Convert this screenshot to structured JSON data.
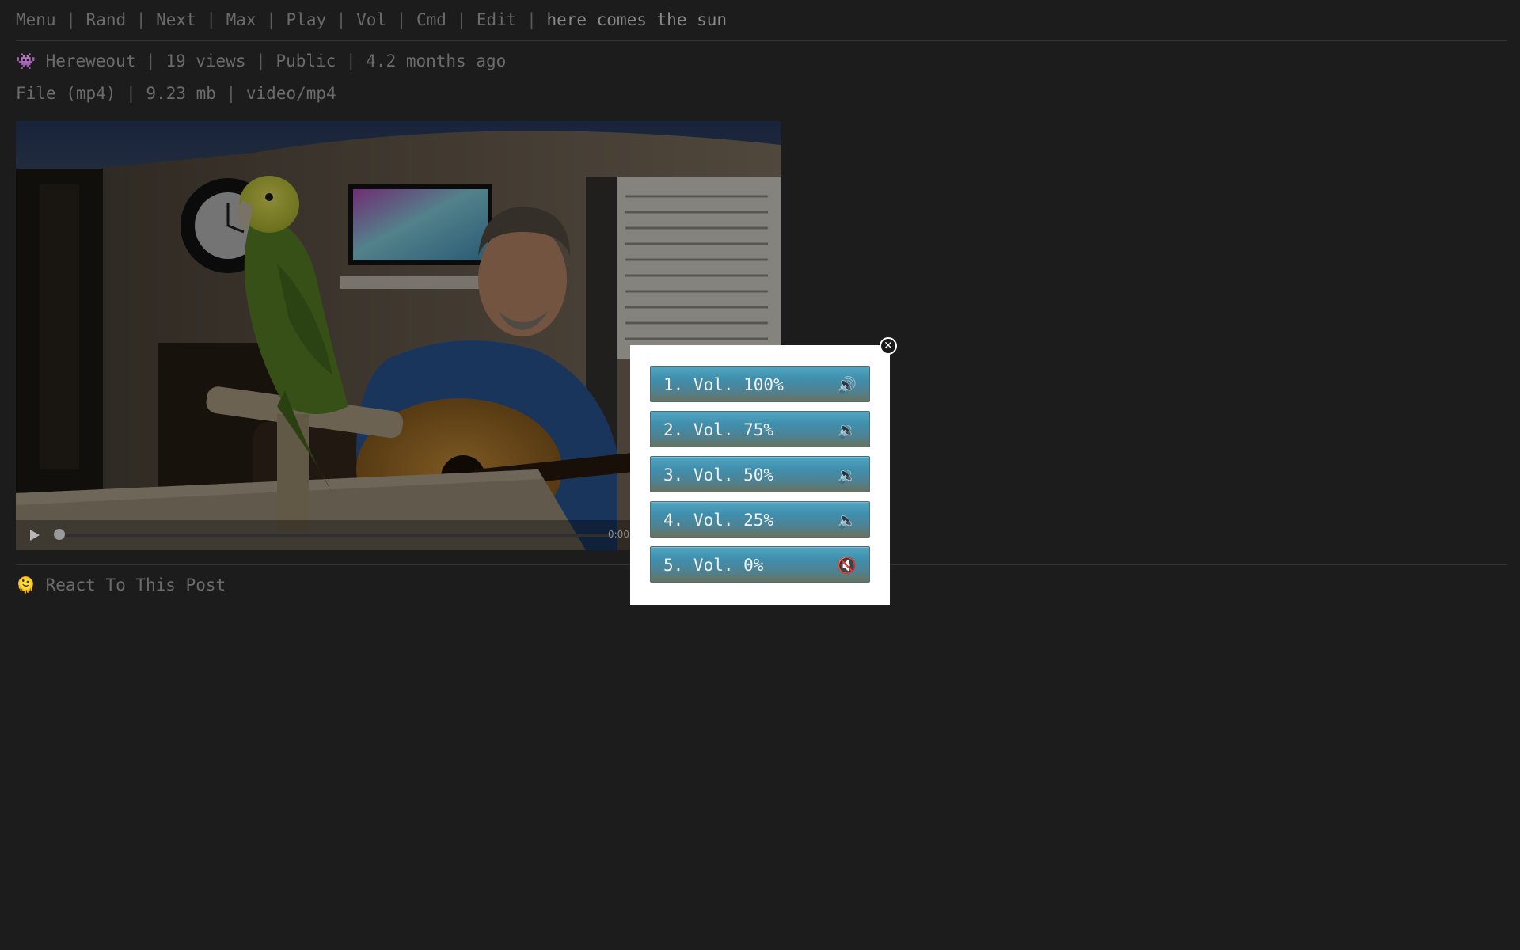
{
  "nav": {
    "items": [
      "Menu",
      "Rand",
      "Next",
      "Max",
      "Play",
      "Vol",
      "Cmd",
      "Edit"
    ],
    "separator": "|",
    "title": "here comes the sun"
  },
  "meta": {
    "author_icon": "👾",
    "author": "Hereweout",
    "views": "19 views",
    "visibility": "Public",
    "posted": "4.2 months ago",
    "file_type": "File (mp4)",
    "file_size": "9.23 mb",
    "mime": "video/mp4"
  },
  "player": {
    "time": "0:00",
    "progress": 0
  },
  "react": {
    "icon": "🫠",
    "label": "React To This Post"
  },
  "volume_dialog": {
    "close_symbol": "✕",
    "options": [
      {
        "label": "1. Vol. 100%",
        "icon": "🔊"
      },
      {
        "label": "2. Vol. 75%",
        "icon": "🔉"
      },
      {
        "label": "3. Vol. 50%",
        "icon": "🔉"
      },
      {
        "label": "4. Vol. 25%",
        "icon": "🔈"
      },
      {
        "label": "5. Vol. 0%",
        "icon": "🔇"
      }
    ]
  }
}
